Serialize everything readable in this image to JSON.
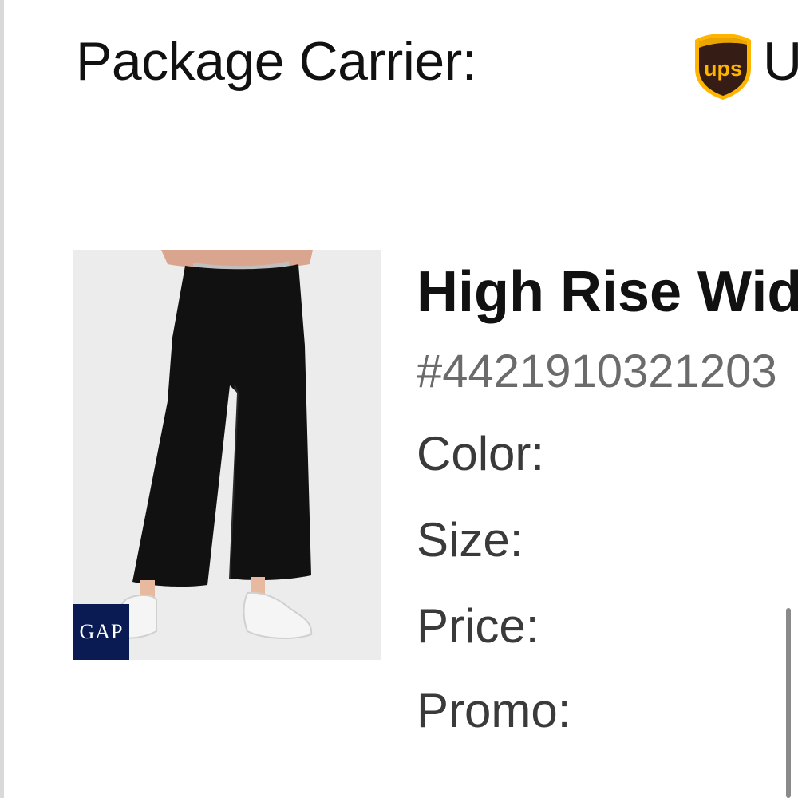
{
  "shipment": {
    "carrier_label": "Package Carrier:",
    "carrier_name": "U",
    "carrier_logo_text": "ups",
    "carrier_logo_icon": "ups-shield-icon"
  },
  "product": {
    "title": "High Rise Wid",
    "sku": "#4421910321203",
    "brand_badge": "GAP",
    "image_icon": "black-wide-leg-pants-image",
    "details": {
      "color_label": "Color:",
      "size_label": "Size:",
      "price_label": "Price:",
      "promo_label": "Promo:"
    }
  },
  "colors": {
    "text": "#111111",
    "sku": "#6b6b6b",
    "label": "#3a3a3a",
    "ups_brown": "#351c15",
    "ups_gold": "#ffb500",
    "gap_navy": "#0a1a52",
    "pants": "#111111"
  }
}
